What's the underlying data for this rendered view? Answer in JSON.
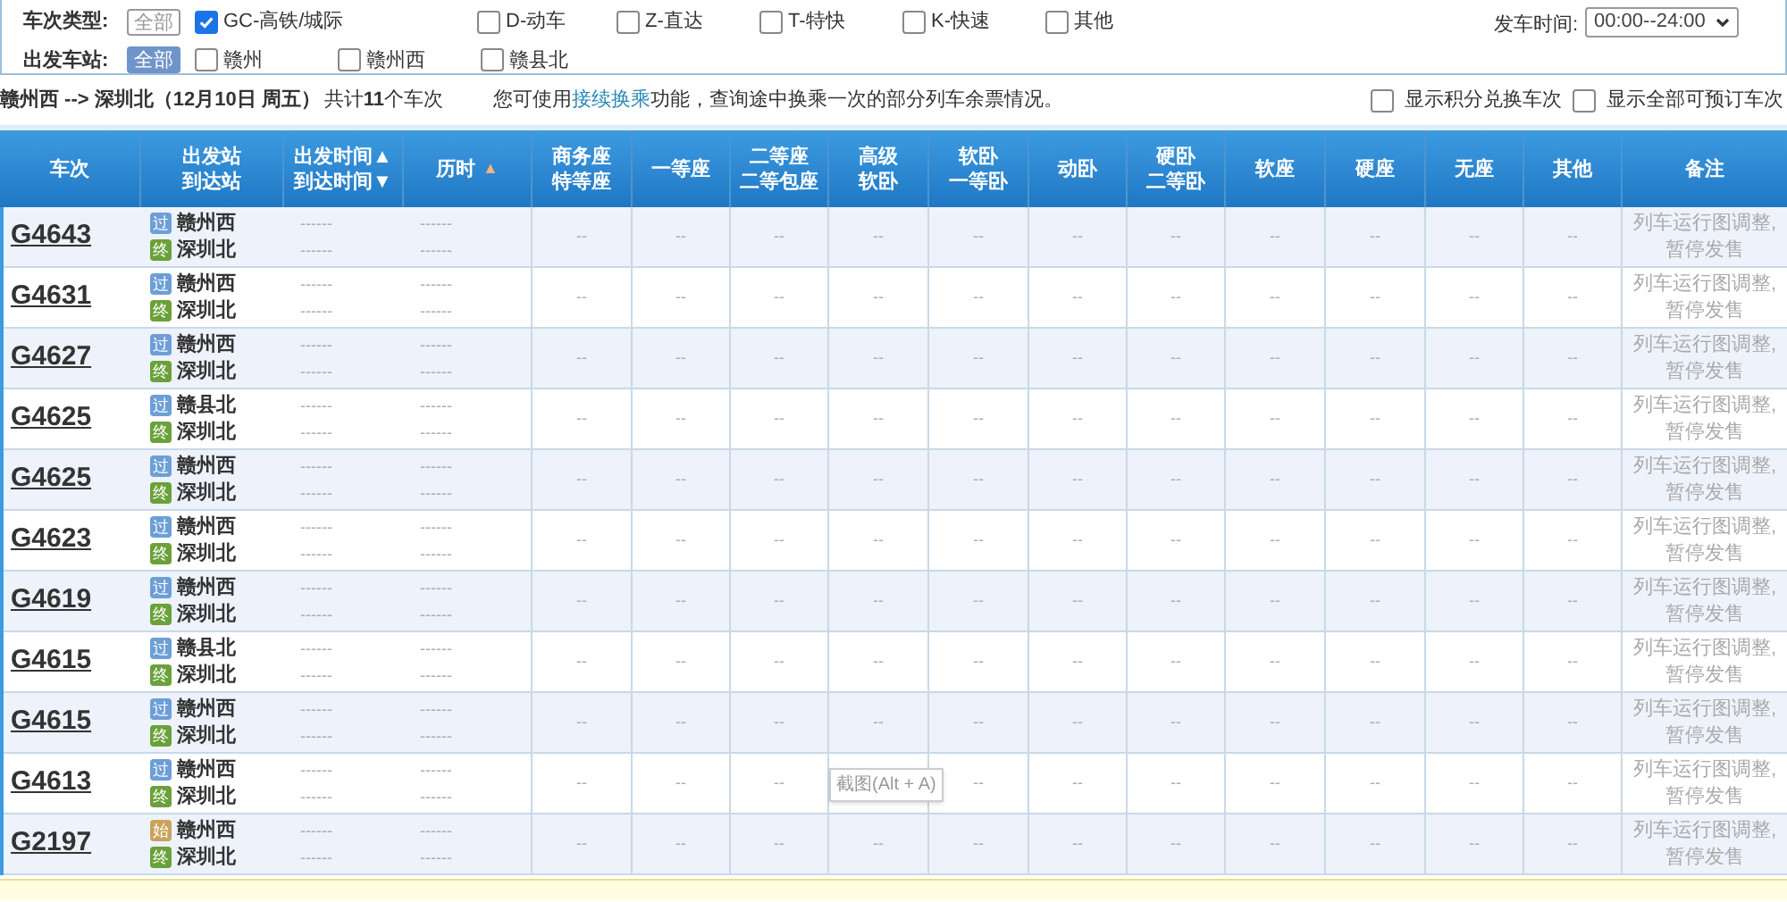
{
  "filters": {
    "type_label": "车次类型:",
    "type_all": {
      "label": "全部",
      "selected": false
    },
    "types": [
      {
        "label": "GC-高铁/城际",
        "checked": true
      },
      {
        "label": "D-动车",
        "checked": false
      },
      {
        "label": "Z-直达",
        "checked": false
      },
      {
        "label": "T-特快",
        "checked": false
      },
      {
        "label": "K-快速",
        "checked": false
      },
      {
        "label": "其他",
        "checked": false
      }
    ],
    "station_label": "出发车站:",
    "station_all": {
      "label": "全部",
      "selected": true
    },
    "stations": [
      {
        "label": "赣州",
        "checked": false
      },
      {
        "label": "赣州西",
        "checked": false
      },
      {
        "label": "赣县北",
        "checked": false
      }
    ],
    "time_label": "发车时间:",
    "time_value": "00:00--24:00"
  },
  "summary": {
    "route": "赣州西 --> 深圳北（12月10日  周五）",
    "count": "共计**11**个车次",
    "notice_before": "您可使用",
    "notice_link": "接续换乘",
    "notice_after": "功能，查询途中换乘一次的部分列车余票情况。",
    "options": [
      {
        "label": "显示积分兑换车次",
        "checked": false
      },
      {
        "label": "显示全部可预订车次",
        "checked": false
      }
    ]
  },
  "table": {
    "columns": [
      {
        "lines": [
          "车次"
        ]
      },
      {
        "lines": [
          "出发站",
          "到达站"
        ]
      },
      {
        "lines": [
          "出发时间▲",
          "到达时间▼"
        ]
      },
      {
        "lines": [
          "历时"
        ],
        "sort": "▲"
      },
      {
        "lines": [
          "商务座",
          "特等座"
        ]
      },
      {
        "lines": [
          "一等座"
        ]
      },
      {
        "lines": [
          "二等座",
          "二等包座"
        ]
      },
      {
        "lines": [
          "高级",
          "软卧"
        ]
      },
      {
        "lines": [
          "软卧",
          "一等卧"
        ]
      },
      {
        "lines": [
          "动卧"
        ]
      },
      {
        "lines": [
          "硬卧",
          "二等卧"
        ]
      },
      {
        "lines": [
          "软座"
        ]
      },
      {
        "lines": [
          "硬座"
        ]
      },
      {
        "lines": [
          "无座"
        ]
      },
      {
        "lines": [
          "其他"
        ]
      },
      {
        "lines": [
          "备注"
        ]
      }
    ],
    "rows": [
      {
        "train": "G4643",
        "from": {
          "badge": "过",
          "kind": "pass",
          "name": "赣州西"
        },
        "to": {
          "badge": "终",
          "kind": "end",
          "name": "深圳北"
        },
        "times": [
          "------",
          "------"
        ],
        "duration": [
          "------",
          "------"
        ],
        "seats": [
          "--",
          "--",
          "--",
          "--",
          "--",
          "--",
          "--",
          "--",
          "--",
          "--",
          "--"
        ],
        "note": "列车运行图调整,暂停发售"
      },
      {
        "train": "G4631",
        "from": {
          "badge": "过",
          "kind": "pass",
          "name": "赣州西"
        },
        "to": {
          "badge": "终",
          "kind": "end",
          "name": "深圳北"
        },
        "times": [
          "------",
          "------"
        ],
        "duration": [
          "------",
          "------"
        ],
        "seats": [
          "--",
          "--",
          "--",
          "--",
          "--",
          "--",
          "--",
          "--",
          "--",
          "--",
          "--"
        ],
        "note": "列车运行图调整,暂停发售"
      },
      {
        "train": "G4627",
        "from": {
          "badge": "过",
          "kind": "pass",
          "name": "赣州西"
        },
        "to": {
          "badge": "终",
          "kind": "end",
          "name": "深圳北"
        },
        "times": [
          "------",
          "------"
        ],
        "duration": [
          "------",
          "------"
        ],
        "seats": [
          "--",
          "--",
          "--",
          "--",
          "--",
          "--",
          "--",
          "--",
          "--",
          "--",
          "--"
        ],
        "note": "列车运行图调整,暂停发售"
      },
      {
        "train": "G4625",
        "from": {
          "badge": "过",
          "kind": "pass",
          "name": "赣县北"
        },
        "to": {
          "badge": "终",
          "kind": "end",
          "name": "深圳北"
        },
        "times": [
          "------",
          "------"
        ],
        "duration": [
          "------",
          "------"
        ],
        "seats": [
          "--",
          "--",
          "--",
          "--",
          "--",
          "--",
          "--",
          "--",
          "--",
          "--",
          "--"
        ],
        "note": "列车运行图调整,暂停发售"
      },
      {
        "train": "G4625",
        "from": {
          "badge": "过",
          "kind": "pass",
          "name": "赣州西"
        },
        "to": {
          "badge": "终",
          "kind": "end",
          "name": "深圳北"
        },
        "times": [
          "------",
          "------"
        ],
        "duration": [
          "------",
          "------"
        ],
        "seats": [
          "--",
          "--",
          "--",
          "--",
          "--",
          "--",
          "--",
          "--",
          "--",
          "--",
          "--"
        ],
        "note": "列车运行图调整,暂停发售"
      },
      {
        "train": "G4623",
        "from": {
          "badge": "过",
          "kind": "pass",
          "name": "赣州西"
        },
        "to": {
          "badge": "终",
          "kind": "end",
          "name": "深圳北"
        },
        "times": [
          "------",
          "------"
        ],
        "duration": [
          "------",
          "------"
        ],
        "seats": [
          "--",
          "--",
          "--",
          "--",
          "--",
          "--",
          "--",
          "--",
          "--",
          "--",
          "--"
        ],
        "note": "列车运行图调整,暂停发售"
      },
      {
        "train": "G4619",
        "from": {
          "badge": "过",
          "kind": "pass",
          "name": "赣州西"
        },
        "to": {
          "badge": "终",
          "kind": "end",
          "name": "深圳北"
        },
        "times": [
          "------",
          "------"
        ],
        "duration": [
          "------",
          "------"
        ],
        "seats": [
          "--",
          "--",
          "--",
          "--",
          "--",
          "--",
          "--",
          "--",
          "--",
          "--",
          "--"
        ],
        "note": "列车运行图调整,暂停发售"
      },
      {
        "train": "G4615",
        "from": {
          "badge": "过",
          "kind": "pass",
          "name": "赣县北"
        },
        "to": {
          "badge": "终",
          "kind": "end",
          "name": "深圳北"
        },
        "times": [
          "------",
          "------"
        ],
        "duration": [
          "------",
          "------"
        ],
        "seats": [
          "--",
          "--",
          "--",
          "--",
          "--",
          "--",
          "--",
          "--",
          "--",
          "--",
          "--"
        ],
        "note": "列车运行图调整,暂停发售"
      },
      {
        "train": "G4615",
        "from": {
          "badge": "过",
          "kind": "pass",
          "name": "赣州西"
        },
        "to": {
          "badge": "终",
          "kind": "end",
          "name": "深圳北"
        },
        "times": [
          "------",
          "------"
        ],
        "duration": [
          "------",
          "------"
        ],
        "seats": [
          "--",
          "--",
          "--",
          "--",
          "--",
          "--",
          "--",
          "--",
          "--",
          "--",
          "--"
        ],
        "note": "列车运行图调整,暂停发售"
      },
      {
        "train": "G4613",
        "from": {
          "badge": "过",
          "kind": "pass",
          "name": "赣州西"
        },
        "to": {
          "badge": "终",
          "kind": "end",
          "name": "深圳北"
        },
        "times": [
          "------",
          "------"
        ],
        "duration": [
          "------",
          "------"
        ],
        "seats": [
          "--",
          "--",
          "--",
          {
            "kind": "tooltip",
            "label": "截图(Alt + A)"
          },
          "--",
          "--",
          "--",
          "--",
          "--",
          "--",
          "--"
        ],
        "note": "列车运行图调整,暂停发售"
      },
      {
        "train": "G2197",
        "from": {
          "badge": "始",
          "kind": "start",
          "name": "赣州西"
        },
        "to": {
          "badge": "终",
          "kind": "end",
          "name": "深圳北"
        },
        "times": [
          "------",
          "------"
        ],
        "duration": [
          "------",
          "------"
        ],
        "seats": [
          "--",
          "--",
          "--",
          "--",
          "--",
          "--",
          "--",
          "--",
          "--",
          "--",
          "--"
        ],
        "note": "列车运行图调整,暂停发售"
      }
    ]
  }
}
